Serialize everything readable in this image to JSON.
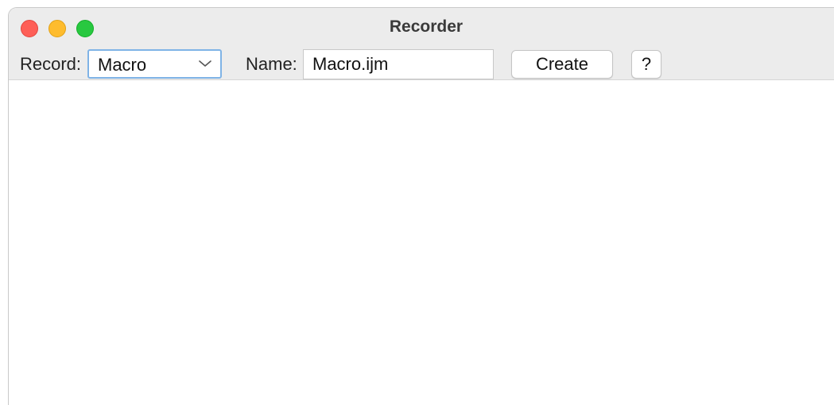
{
  "window": {
    "title": "Recorder"
  },
  "toolbar": {
    "record_label": "Record:",
    "record_select": {
      "selected": "Macro",
      "icon": "chevron-down-icon"
    },
    "name_label": "Name:",
    "name_field": {
      "value": "Macro.ijm"
    },
    "create_label": "Create",
    "help_label": "?"
  },
  "colors": {
    "close": "#fe5f57",
    "minimize": "#febc2e",
    "zoom": "#28c840",
    "focus_ring": "#7fb3e6"
  }
}
